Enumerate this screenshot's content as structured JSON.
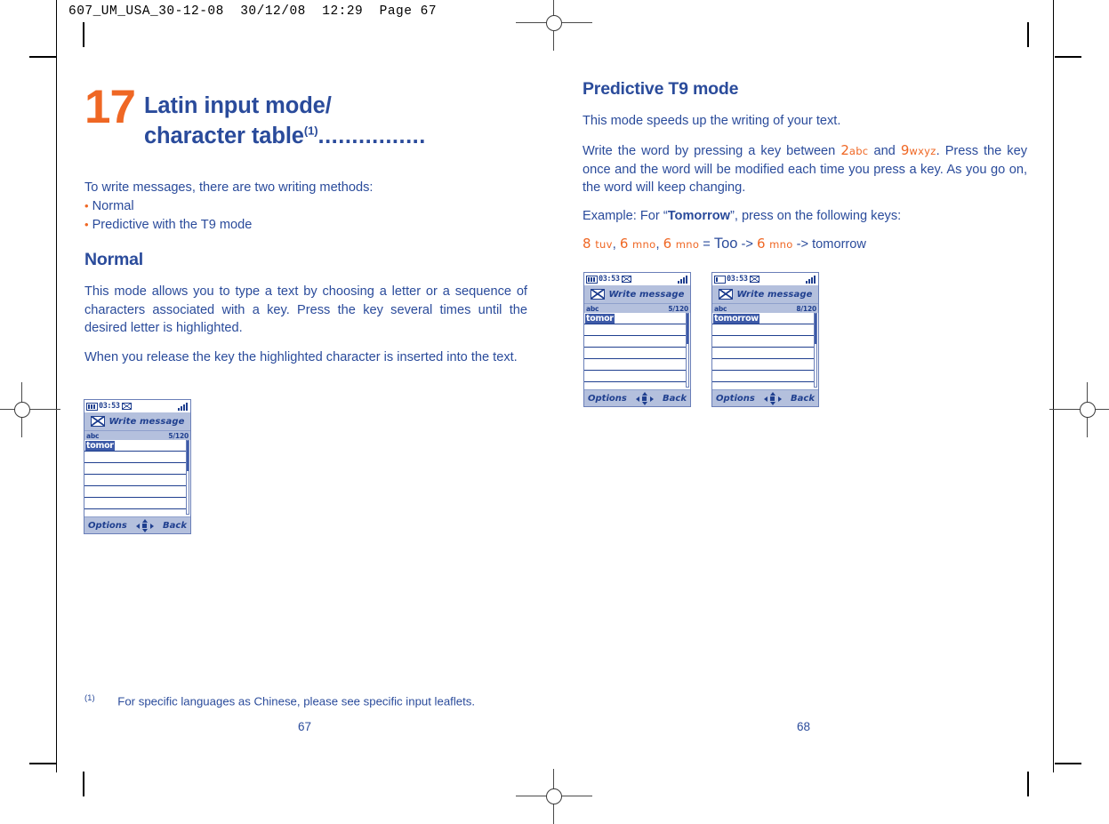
{
  "print_header": {
    "text": "607_UM_USA_30-12-08  30/12/08  12:29  Page 67"
  },
  "colors": {
    "ink_blue": "#2a4b9b",
    "accent_orange": "#ef6724",
    "phone_chrome": "#b4c0dd",
    "phone_ink": "#1f3f8f",
    "highlight": "#3d5aa8"
  },
  "left_page": {
    "chapter_number": "17",
    "chapter_title_line1": "Latin input mode/",
    "chapter_title_line2": "character table",
    "chapter_footnote_mark": "(1)",
    "chapter_dots": "................",
    "intro": "To write messages, there are two writing methods:",
    "bullets": [
      "Normal",
      "Predictive with the T9 mode"
    ],
    "section_heading": "Normal",
    "paragraph_1": "This mode allows you to type a text by choosing a letter or a sequence of characters associated with a key. Press the key several times until the desired letter is highlighted.",
    "paragraph_2": "When you release the key the highlighted character is inserted into the text.",
    "footnote_mark": "(1)",
    "footnote_text": "For specific languages as Chinese, please see specific input leaflets.",
    "folio": "67"
  },
  "right_page": {
    "section_heading": "Predictive T9 mode",
    "paragraph_1": "This mode speeds up the writing of your text.",
    "paragraph_2_part1": "Write the word by pressing a key between",
    "key_low_digit": "2",
    "key_low_letters": "abc",
    "paragraph_2_and": "and",
    "key_high_digit": "9",
    "key_high_letters": "wxyz",
    "paragraph_2_part2": ". Press the key once and the word will be modified each time you press a key. As you go on, the word will keep changing.",
    "example_label": "Example: For “",
    "example_word": "Tomorrow",
    "example_label_end": "”, press on the following keys:",
    "key_sequence": {
      "k1_digit": "8",
      "k1_letters": "tuv",
      "sep1": ",",
      "k2_digit": "6",
      "k2_letters": "mno",
      "sep2": ",",
      "k3_digit": "6",
      "k3_letters": "mno",
      "equals": "=",
      "result1": "Too",
      "arrow1": "->",
      "k4_digit": "6",
      "k4_letters": "mno",
      "arrow2": "->",
      "result2": "tomorrow"
    },
    "folio": "68"
  },
  "phone_screens": [
    {
      "id": "phone-left-normal",
      "clock": "03:53",
      "title": "Write message",
      "mode": "abc",
      "counter": "5/120",
      "text": "tomor",
      "softkey_left": "Options",
      "softkey_right": "Back",
      "battery_level": "full"
    },
    {
      "id": "phone-t9-partial",
      "clock": "03:53",
      "title": "Write message",
      "mode": "abc",
      "counter": "5/120",
      "text": "tomor",
      "softkey_left": "Options",
      "softkey_right": "Back",
      "battery_level": "full"
    },
    {
      "id": "phone-t9-complete",
      "clock": "03:53",
      "title": "Write message",
      "mode": "abc",
      "counter": "8/120",
      "text": "tomorrow",
      "softkey_left": "Options",
      "softkey_right": "Back",
      "battery_level": "half"
    }
  ]
}
